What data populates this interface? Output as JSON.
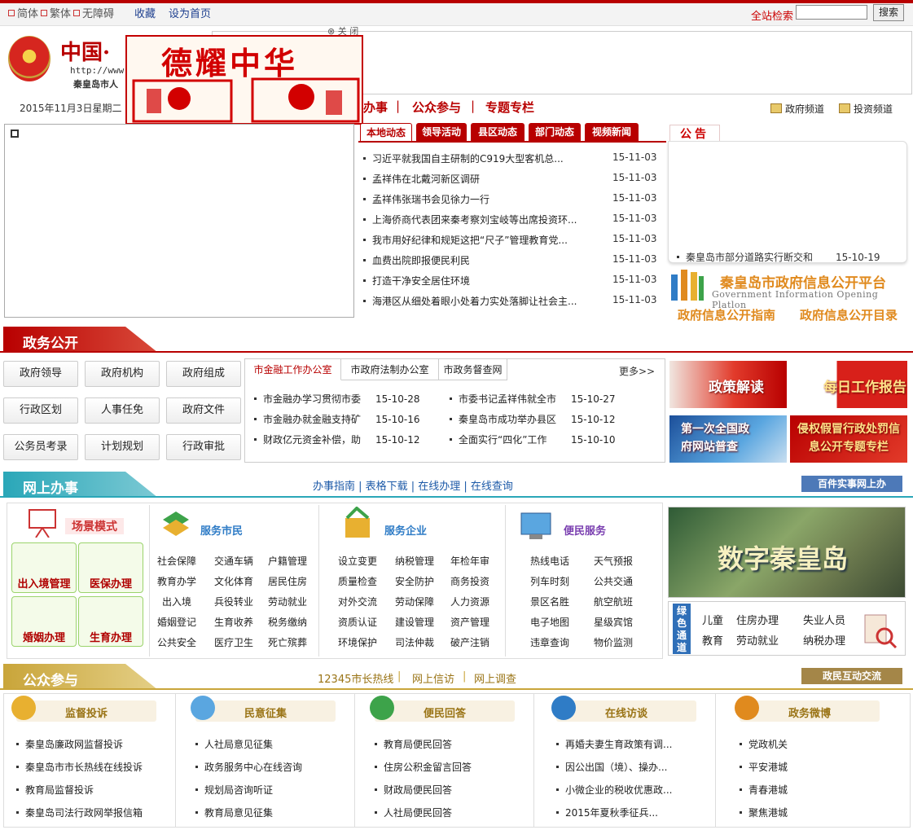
{
  "topbar": {
    "simplified": "简体",
    "traditional": "繁体",
    "accessible": "无障碍",
    "bookmark": "收藏",
    "set_home": "设为首页",
    "search_label": "全站检索",
    "search_value": "",
    "search_button": "搜索"
  },
  "header": {
    "logo_text": "中国·",
    "logo_url": "http://www.",
    "logo_sub": "秦皇岛市人",
    "close_ad": "⊗ 关 闭",
    "float_ad_title": "德耀中华"
  },
  "nav": {
    "date": "2015年11月3日星期二",
    "items": [
      "办事",
      "公众参与",
      "专题专栏"
    ],
    "channel_gov": "政府频道",
    "channel_invest": "投资频道"
  },
  "news": {
    "tabs": [
      "本地动态",
      "领导活动",
      "县区动态",
      "部门动态",
      "视频新闻"
    ],
    "items": [
      {
        "title": "习近平就我国自主研制的C919大型客机总...",
        "date": "15-11-03"
      },
      {
        "title": "孟祥伟在北戴河新区调研",
        "date": "15-11-03"
      },
      {
        "title": "孟祥伟张瑞书会见徐力一行",
        "date": "15-11-03"
      },
      {
        "title": "上海侨商代表团来秦考察刘宝岐等出席投资环...",
        "date": "15-11-03"
      },
      {
        "title": "我市用好纪律和规矩这把“尺子”管理教育党...",
        "date": "15-11-03"
      },
      {
        "title": "血费出院即报便民利民",
        "date": "15-11-03"
      },
      {
        "title": "打造干净安全居住环境",
        "date": "15-11-03"
      },
      {
        "title": "海港区从细处着眼小处着力实处落脚让社会主...",
        "date": "15-11-03"
      }
    ]
  },
  "notice": {
    "tab": "公告",
    "item": "秦皇岛市部分道路实行断交和",
    "item_date": "15-10-19"
  },
  "govinfo": {
    "title": "秦皇岛市政府信息公开平台",
    "subtitle": "Government Information Opening Platlon",
    "guide": "政府信息公开指南",
    "catalog": "政府信息公开目录"
  },
  "gov_open": {
    "heading": "政务公开",
    "buttons": [
      "政府领导",
      "政府机构",
      "政府组成",
      "行政区划",
      "人事任免",
      "政府文件",
      "公务员考录",
      "计划规划",
      "行政审批"
    ],
    "office_tabs": [
      "市金融工作办公室",
      "市政府法制办公室",
      "市政务督查网"
    ],
    "more": "更多>>",
    "office_items": [
      {
        "title": "市金融办学习贯彻市委",
        "date": "15-10-28"
      },
      {
        "title": "市委书记孟祥伟就全市",
        "date": "15-10-27"
      },
      {
        "title": "市金融办就金融支持矿",
        "date": "15-10-16"
      },
      {
        "title": "秦皇岛市成功举办县区",
        "date": "15-10-12"
      },
      {
        "title": "财政亿元资金补偿，助",
        "date": "15-10-12"
      },
      {
        "title": "全面实行“四化”工作",
        "date": "15-10-10"
      }
    ],
    "promos": [
      "政策解读",
      "每日工作报告",
      "第一次全国政府网站普查",
      "侵权假冒行政处罚信息公开专题专栏"
    ]
  },
  "online": {
    "heading": "网上办事",
    "links": "办事指南 | 表格下载 | 在线办理 | 在线查询",
    "button": "百件实事网上办",
    "scene_title": "场景模式",
    "scenes": [
      "出入境管理",
      "医保办理",
      "婚姻办理",
      "生育办理"
    ],
    "citizen_title": "服务市民",
    "citizen": [
      "社会保障",
      "交通车辆",
      "户籍管理",
      "教育办学",
      "文化体育",
      "居民住房",
      "出入境",
      "兵役转业",
      "劳动就业",
      "婚姻登记",
      "生育收养",
      "税务缴纳",
      "公共安全",
      "医疗卫生",
      "死亡殡葬"
    ],
    "enterprise_title": "服务企业",
    "enterprise": [
      "设立变更",
      "纳税管理",
      "年检年审",
      "质量检查",
      "安全防护",
      "商务投资",
      "对外交流",
      "劳动保障",
      "人力资源",
      "资质认证",
      "建设管理",
      "资产管理",
      "环境保护",
      "司法仲裁",
      "破产注销"
    ],
    "convenience_title": "便民服务",
    "convenience": [
      "热线电话",
      "天气预报",
      "列车时刻",
      "公共交通",
      "景区名胜",
      "航空航班",
      "电子地图",
      "星级宾馆",
      "违章查询",
      "物价监测"
    ],
    "digital_title": "数字秦皇岛",
    "green_label": "绿色通道",
    "green": [
      "儿童",
      "住房办理",
      "失业人员",
      "教育",
      "劳动就业",
      "纳税办理"
    ]
  },
  "public": {
    "heading": "公众参与",
    "links": [
      "12345市长热线",
      "网上信访",
      "网上调查"
    ],
    "button": "政民互动交流",
    "columns": [
      {
        "title": "监督投诉",
        "items": [
          "秦皇岛廉政网监督投诉",
          "秦皇岛市市长热线在线投诉",
          "教育局监督投诉",
          "秦皇岛司法行政网举报信箱"
        ]
      },
      {
        "title": "民意征集",
        "items": [
          "人社局意见征集",
          "政务服务中心在线咨询",
          "规划局咨询听证",
          "教育局意见征集"
        ]
      },
      {
        "title": "便民回答",
        "items": [
          "教育局便民回答",
          "住房公积金留言回答",
          "财政局便民回答",
          "人社局便民回答"
        ]
      },
      {
        "title": "在线访谈",
        "items": [
          "再婚夫妻生育政策有调...",
          "因公出国（境）、操办...",
          "小微企业的税收优惠政...",
          "2015年夏秋季征兵..."
        ]
      },
      {
        "title": "政务微博",
        "items": [
          "党政机关",
          "平安港城",
          "青春港城",
          "聚焦港城"
        ]
      }
    ]
  },
  "colors": {
    "brand_red": "#b80000",
    "online_teal": "#2aa7b8",
    "public_gold": "#c9a53a",
    "gov_orange": "#e08a1e"
  }
}
